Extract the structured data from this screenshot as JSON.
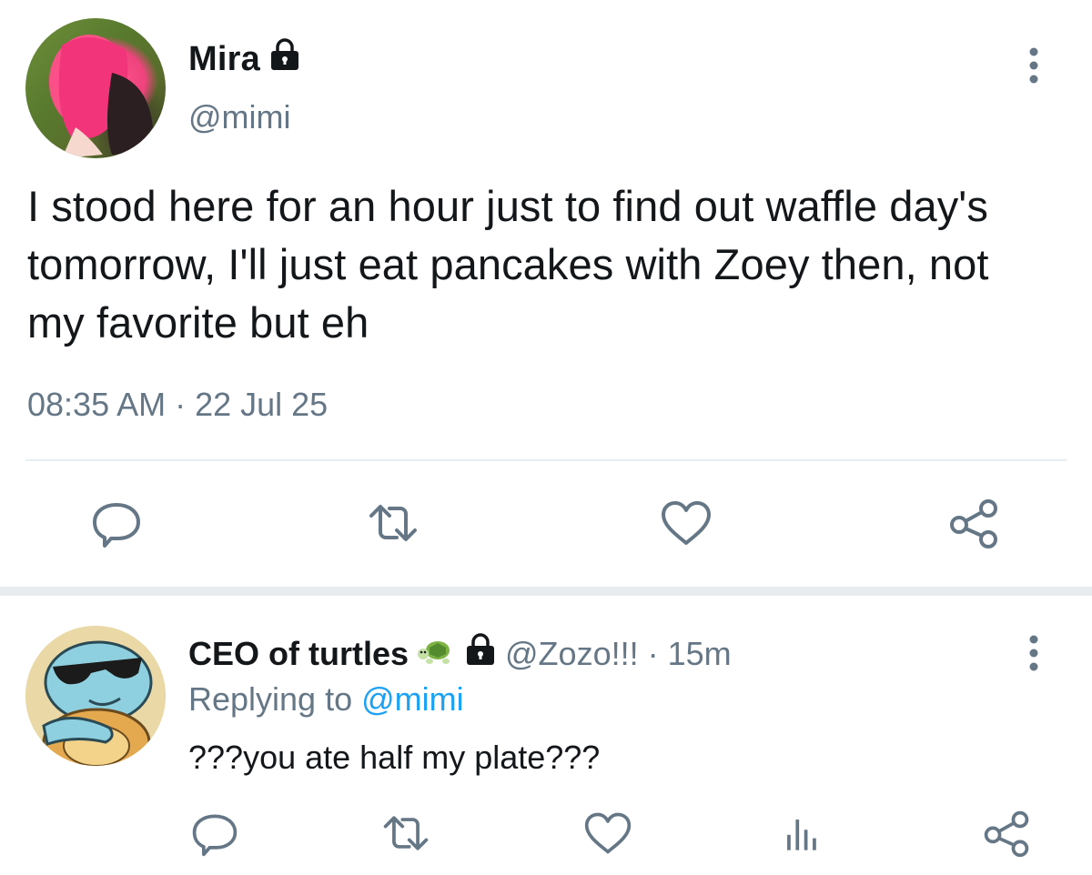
{
  "tweet": {
    "author_name": "Mira",
    "author_handle": "@mimi",
    "protected_icon": "lock-icon",
    "text": "I stood here for an hour just to find out waffle day's tomorrow, I'll just eat pancakes with Zoey then, not my favorite but eh",
    "timestamp": "08:35 AM · 22 Jul 25",
    "actions": [
      "reply-icon",
      "retweet-icon",
      "like-icon",
      "share-icon"
    ]
  },
  "reply": {
    "author_name": "CEO of turtles",
    "emoji_icon": "turtle-icon",
    "protected_icon": "lock-icon",
    "author_handle": "@Zozo!!!",
    "separator": "·",
    "time": "15m",
    "replying_label": "Replying to",
    "replying_mention": "@mimi",
    "text": "???you ate half my plate???",
    "actions": [
      "reply-icon",
      "retweet-icon",
      "like-icon",
      "analytics-icon",
      "share-icon"
    ]
  },
  "colors": {
    "text": "#14171a",
    "muted": "#657786",
    "link": "#1da1f2",
    "divider": "#e6ecf0",
    "icon": "#657786"
  }
}
